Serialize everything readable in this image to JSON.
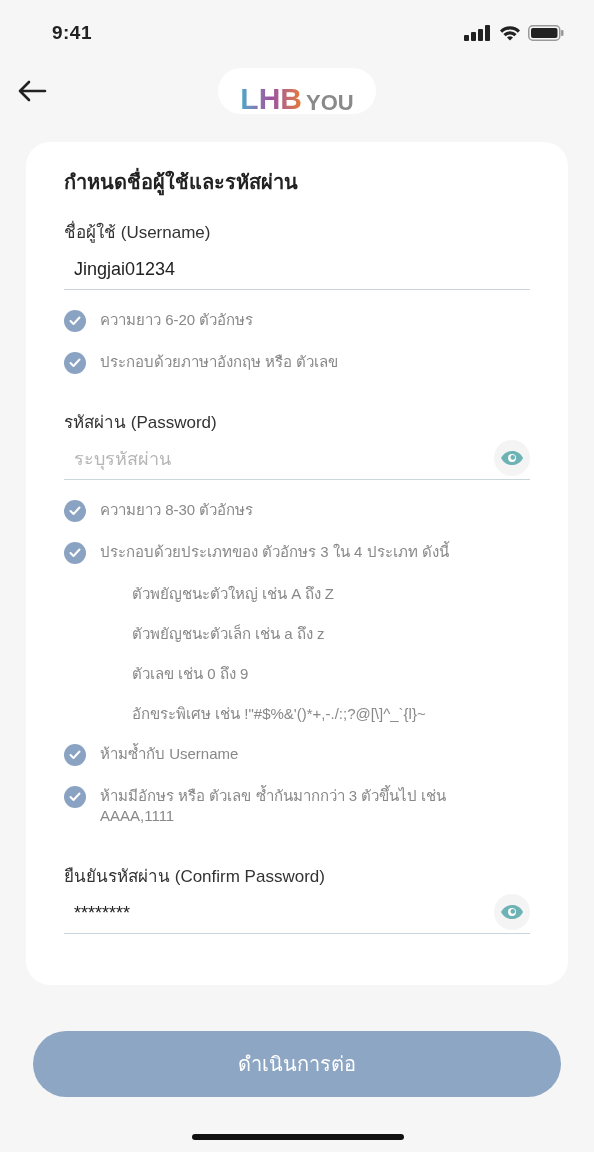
{
  "status_bar": {
    "time": "9:41"
  },
  "header": {
    "logo": {
      "main": "LHB",
      "suffix": "YOU"
    }
  },
  "form": {
    "title": "กำหนดชื่อผู้ใช้และรหัสผ่าน",
    "username": {
      "label": "ชื่อผู้ใช้ (Username)",
      "value": "Jingjai01234",
      "rules": [
        {
          "kind": "check",
          "text": "ความยาว 6-20 ตัวอักษร",
          "checked": true
        },
        {
          "kind": "check",
          "text": "ประกอบด้วยภาษาอังกฤษ หรือ ตัวเลข",
          "checked": true
        }
      ]
    },
    "password": {
      "label": "รหัสผ่าน (Password)",
      "placeholder": "ระบุรหัสผ่าน",
      "rules": [
        {
          "kind": "check",
          "text": "ความยาว 8-30 ตัวอักษร",
          "checked": true
        },
        {
          "kind": "check",
          "text": "ประกอบด้วยประเภทของ ตัวอักษร 3 ใน 4 ประเภท ดังนี้",
          "checked": true
        },
        {
          "kind": "sub",
          "text": "ตัวพยัญชนะตัวใหญ่ เช่น A ถึง Z"
        },
        {
          "kind": "sub",
          "text": "ตัวพยัญชนะตัวเล็ก เช่น a ถึง z"
        },
        {
          "kind": "sub",
          "text": "ตัวเลข เช่น 0 ถึง 9"
        },
        {
          "kind": "sub",
          "text": "อักขระพิเศษ เช่น !\"#$%&'()*+,-./:;?@[\\]^_`{l}~"
        },
        {
          "kind": "check",
          "text": "ห้ามซ้ำกับ Username",
          "checked": true
        },
        {
          "kind": "check",
          "text": "ห้ามมีอักษร หรือ ตัวเลข ซ้ำกันมากกว่า 3 ตัวขึ้นไป เช่น AAAA,1111",
          "checked": true
        }
      ]
    },
    "confirm": {
      "label": "ยืนยันรหัสผ่าน (Confirm Password)",
      "value": "********"
    }
  },
  "continue_button": {
    "label": "ดำเนินการต่อ"
  }
}
